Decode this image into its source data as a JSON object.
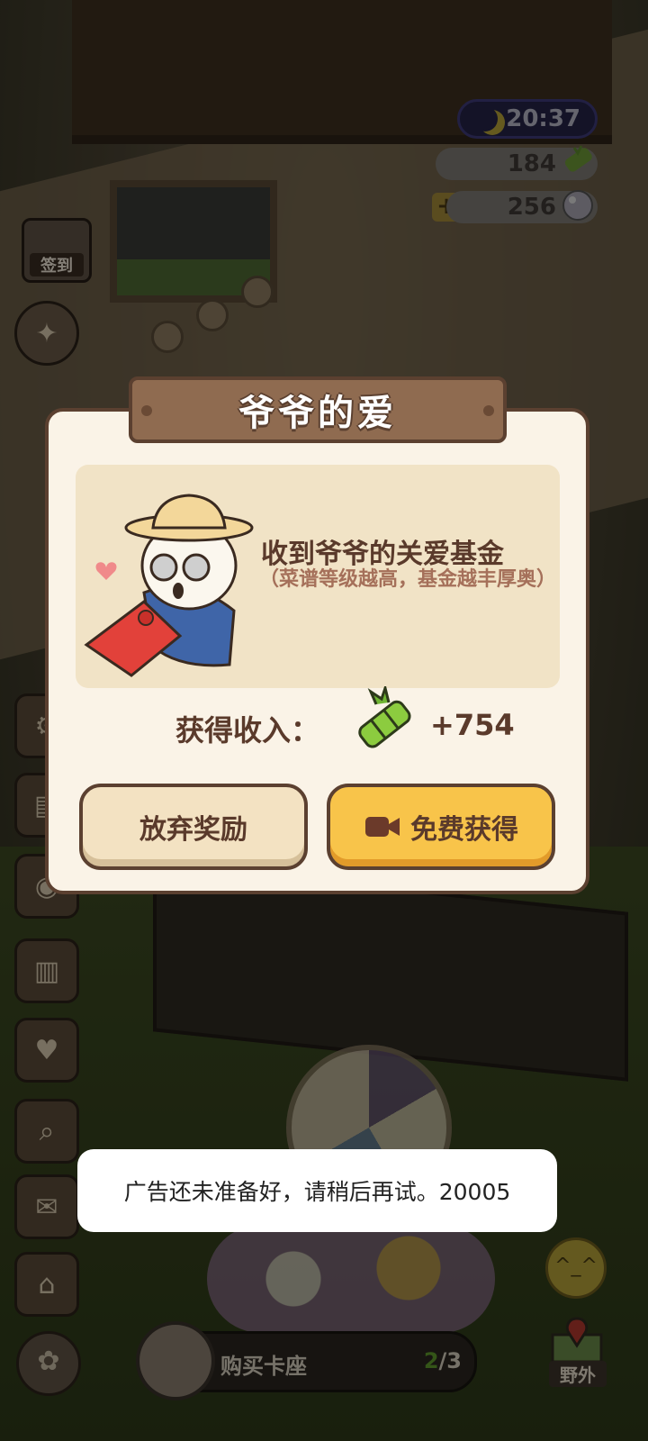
{
  "hud": {
    "time": "20:37",
    "bamboo_count": "184",
    "pearl_count": "256",
    "plus_symbol": "+",
    "signin_label": "签到",
    "colors": {
      "clock_bg": "#262447",
      "bamboo_green": "#7cb73a"
    }
  },
  "dialog": {
    "title": "爷爷的爱",
    "fund_title": "收到爷爷的关爱基金",
    "fund_note": "（菜谱等级越高，基金越丰厚奥）",
    "income_label": "获得收入：",
    "income_value": "+754",
    "abandon_label": "放弃奖励",
    "free_label": "免费获得",
    "colors": {
      "free_button": "#f8c44a",
      "abandon_button": "#f3e2c2",
      "border": "#5b4030"
    }
  },
  "toast": {
    "message": "广告还未准备好，请稍后再试。20005"
  },
  "bottom": {
    "buy_label": "购买卡座",
    "buy_current": "2",
    "buy_total": "/3",
    "wild_label": "野外"
  },
  "icons": [
    "moon-icon",
    "bamboo-icon",
    "pearl-icon",
    "plus-icon",
    "video-icon",
    "grandpa-panda-illustration",
    "paw-icon",
    "smile-icon",
    "map-pin-icon",
    "gear-icon",
    "recipe-book-icon",
    "shirt-icon",
    "magnifier-icon",
    "mushroom-house-icon"
  ]
}
